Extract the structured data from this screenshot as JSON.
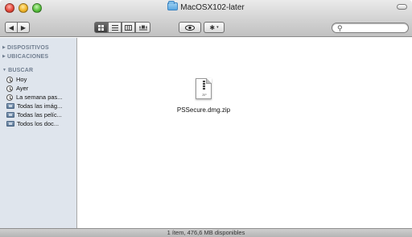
{
  "window": {
    "title": "MacOSX102-later"
  },
  "toolbar": {
    "back_icon": "◀",
    "forward_icon": "▶",
    "view_modes": [
      "icon",
      "list",
      "column",
      "cover-flow"
    ],
    "quicklook_icon": "eye-icon",
    "action_icon": "gear-icon",
    "search_placeholder": ""
  },
  "sidebar": {
    "sections": {
      "devices": "DISPOSITIVOS",
      "places": "UBICACIONES",
      "search": "BUSCAR"
    },
    "search_items": [
      {
        "label": "Hoy",
        "icon": "clock-icon"
      },
      {
        "label": "Ayer",
        "icon": "clock-icon"
      },
      {
        "label": "La semana pas...",
        "icon": "clock-icon"
      },
      {
        "label": "Todas las imág...",
        "icon": "smart-folder-icon"
      },
      {
        "label": "Todas las pelíc...",
        "icon": "smart-folder-icon"
      },
      {
        "label": "Todos los doc...",
        "icon": "smart-folder-icon"
      }
    ]
  },
  "content": {
    "files": [
      {
        "name": "PSSecure.dmg.zip",
        "icon_label": "ZIP"
      }
    ]
  },
  "status": {
    "text": "1 ítem, 476,6 MB disponibles"
  }
}
